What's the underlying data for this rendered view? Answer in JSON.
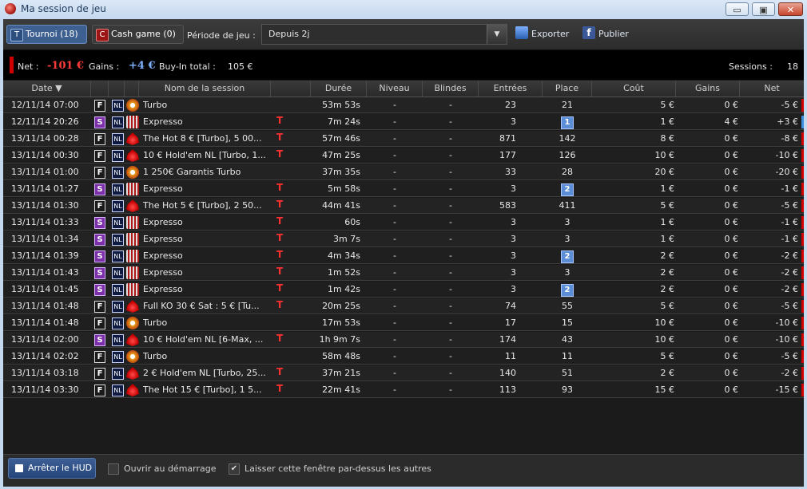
{
  "window": {
    "title": "Ma session de jeu",
    "min": "▭",
    "max": "▣",
    "close": "✕"
  },
  "toolbar": {
    "tournoi": {
      "badge": "T",
      "label": "Tournoi (18)"
    },
    "cash": {
      "badge": "C",
      "label": "Cash game (0)"
    },
    "period_label": "Période de jeu :",
    "period_value": "Depuis 2j",
    "export_label": "Exporter",
    "publish_label": "Publier"
  },
  "summary": {
    "net_label": "Net :",
    "net_value": "-101 €",
    "gains_label": "Gains :",
    "gains_value": "+4 €",
    "buyin_label": "Buy-In total :",
    "buyin_value": "105 €",
    "sessions_label": "Sessions :",
    "sessions_value": "18"
  },
  "columns": {
    "date": "Date ▼",
    "name": "Nom de la session",
    "duree": "Durée",
    "niveau": "Niveau",
    "blindes": "Blindes",
    "entrees": "Entrées",
    "place": "Place",
    "cout": "Coût",
    "gains": "Gains",
    "net": "Net"
  },
  "colors": {
    "accent": "#3b5f95",
    "negative": "#d00000",
    "positive": "#3d8fe0"
  },
  "rows": [
    {
      "date": "12/11/14 07:00",
      "fmt": "F",
      "site": "w",
      "name": "Turbo",
      "t": "",
      "duree": "53m 53s",
      "niveau": "-",
      "blindes": "-",
      "entrees": "23",
      "place": "21",
      "placeBadge": false,
      "cout": "5 €",
      "gains": "0 €",
      "net": "-5 €",
      "sign": "neg"
    },
    {
      "date": "12/11/14 20:26",
      "fmt": "S",
      "site": "e",
      "name": "Expresso",
      "t": "T",
      "duree": "7m 24s",
      "niveau": "-",
      "blindes": "-",
      "entrees": "3",
      "place": "1",
      "placeBadge": true,
      "cout": "1 €",
      "gains": "4 €",
      "net": "+3 €",
      "sign": "pos"
    },
    {
      "date": "13/11/14 00:28",
      "fmt": "F",
      "site": "p",
      "name": "The Hot 8 € [Turbo], 5 00...",
      "t": "T",
      "duree": "57m 46s",
      "niveau": "-",
      "blindes": "-",
      "entrees": "871",
      "place": "142",
      "placeBadge": false,
      "cout": "8 €",
      "gains": "0 €",
      "net": "-8 €",
      "sign": "neg"
    },
    {
      "date": "13/11/14 00:30",
      "fmt": "F",
      "site": "p",
      "name": "10 € Hold'em NL [Turbo, 1...",
      "t": "T",
      "duree": "47m 25s",
      "niveau": "-",
      "blindes": "-",
      "entrees": "177",
      "place": "126",
      "placeBadge": false,
      "cout": "10 €",
      "gains": "0 €",
      "net": "-10 €",
      "sign": "neg"
    },
    {
      "date": "13/11/14 01:00",
      "fmt": "F",
      "site": "w",
      "name": "1 250€ Garantis Turbo",
      "t": "",
      "duree": "37m 35s",
      "niveau": "-",
      "blindes": "-",
      "entrees": "33",
      "place": "28",
      "placeBadge": false,
      "cout": "20 €",
      "gains": "0 €",
      "net": "-20 €",
      "sign": "neg"
    },
    {
      "date": "13/11/14 01:27",
      "fmt": "S",
      "site": "e",
      "name": "Expresso",
      "t": "T",
      "duree": "5m 58s",
      "niveau": "-",
      "blindes": "-",
      "entrees": "3",
      "place": "2",
      "placeBadge": true,
      "cout": "1 €",
      "gains": "0 €",
      "net": "-1 €",
      "sign": "neg"
    },
    {
      "date": "13/11/14 01:30",
      "fmt": "F",
      "site": "p",
      "name": "The Hot 5 € [Turbo], 2 50...",
      "t": "T",
      "duree": "44m 41s",
      "niveau": "-",
      "blindes": "-",
      "entrees": "583",
      "place": "411",
      "placeBadge": false,
      "cout": "5 €",
      "gains": "0 €",
      "net": "-5 €",
      "sign": "neg"
    },
    {
      "date": "13/11/14 01:33",
      "fmt": "S",
      "site": "e",
      "name": "Expresso",
      "t": "T",
      "duree": "60s",
      "niveau": "-",
      "blindes": "-",
      "entrees": "3",
      "place": "3",
      "placeBadge": false,
      "cout": "1 €",
      "gains": "0 €",
      "net": "-1 €",
      "sign": "neg"
    },
    {
      "date": "13/11/14 01:34",
      "fmt": "S",
      "site": "e",
      "name": "Expresso",
      "t": "T",
      "duree": "3m 7s",
      "niveau": "-",
      "blindes": "-",
      "entrees": "3",
      "place": "3",
      "placeBadge": false,
      "cout": "1 €",
      "gains": "0 €",
      "net": "-1 €",
      "sign": "neg"
    },
    {
      "date": "13/11/14 01:39",
      "fmt": "S",
      "site": "e",
      "name": "Expresso",
      "t": "T",
      "duree": "4m 34s",
      "niveau": "-",
      "blindes": "-",
      "entrees": "3",
      "place": "2",
      "placeBadge": true,
      "cout": "2 €",
      "gains": "0 €",
      "net": "-2 €",
      "sign": "neg"
    },
    {
      "date": "13/11/14 01:43",
      "fmt": "S",
      "site": "e",
      "name": "Expresso",
      "t": "T",
      "duree": "1m 52s",
      "niveau": "-",
      "blindes": "-",
      "entrees": "3",
      "place": "3",
      "placeBadge": false,
      "cout": "2 €",
      "gains": "0 €",
      "net": "-2 €",
      "sign": "neg"
    },
    {
      "date": "13/11/14 01:45",
      "fmt": "S",
      "site": "e",
      "name": "Expresso",
      "t": "T",
      "duree": "1m 42s",
      "niveau": "-",
      "blindes": "-",
      "entrees": "3",
      "place": "2",
      "placeBadge": true,
      "cout": "2 €",
      "gains": "0 €",
      "net": "-2 €",
      "sign": "neg"
    },
    {
      "date": "13/11/14 01:48",
      "fmt": "F",
      "site": "p",
      "name": "Full KO 30 € Sat : 5 €  [Tu...",
      "t": "T",
      "duree": "20m 25s",
      "niveau": "-",
      "blindes": "-",
      "entrees": "74",
      "place": "55",
      "placeBadge": false,
      "cout": "5 €",
      "gains": "0 €",
      "net": "-5 €",
      "sign": "neg"
    },
    {
      "date": "13/11/14 01:48",
      "fmt": "F",
      "site": "w",
      "name": "Turbo",
      "t": "",
      "duree": "17m 53s",
      "niveau": "-",
      "blindes": "-",
      "entrees": "17",
      "place": "15",
      "placeBadge": false,
      "cout": "10 €",
      "gains": "0 €",
      "net": "-10 €",
      "sign": "neg"
    },
    {
      "date": "13/11/14 02:00",
      "fmt": "S",
      "site": "p",
      "name": "10 € Hold'em NL [6-Max, ...",
      "t": "T",
      "duree": "1h 9m 7s",
      "niveau": "-",
      "blindes": "-",
      "entrees": "174",
      "place": "43",
      "placeBadge": false,
      "cout": "10 €",
      "gains": "0 €",
      "net": "-10 €",
      "sign": "neg"
    },
    {
      "date": "13/11/14 02:02",
      "fmt": "F",
      "site": "w",
      "name": "Turbo",
      "t": "",
      "duree": "58m 48s",
      "niveau": "-",
      "blindes": "-",
      "entrees": "11",
      "place": "11",
      "placeBadge": false,
      "cout": "5 €",
      "gains": "0 €",
      "net": "-5 €",
      "sign": "neg"
    },
    {
      "date": "13/11/14 03:18",
      "fmt": "F",
      "site": "p",
      "name": "2 € Hold'em NL [Turbo, 25...",
      "t": "T",
      "duree": "37m 21s",
      "niveau": "-",
      "blindes": "-",
      "entrees": "140",
      "place": "51",
      "placeBadge": false,
      "cout": "2 €",
      "gains": "0 €",
      "net": "-2 €",
      "sign": "neg"
    },
    {
      "date": "13/11/14 03:30",
      "fmt": "F",
      "site": "p",
      "name": "The Hot 15 € [Turbo], 1 5...",
      "t": "T",
      "duree": "22m 41s",
      "niveau": "-",
      "blindes": "-",
      "entrees": "113",
      "place": "93",
      "placeBadge": false,
      "cout": "15 €",
      "gains": "0 €",
      "net": "-15 €",
      "sign": "neg"
    }
  ],
  "nl_label": "NL",
  "footer": {
    "stop_hud": "Arrêter le HUD",
    "open_startup": "Ouvrir au démarrage",
    "open_startup_checked": false,
    "stay_on_top": "Laisser cette fenêtre par-dessus les autres",
    "stay_on_top_checked": true
  }
}
